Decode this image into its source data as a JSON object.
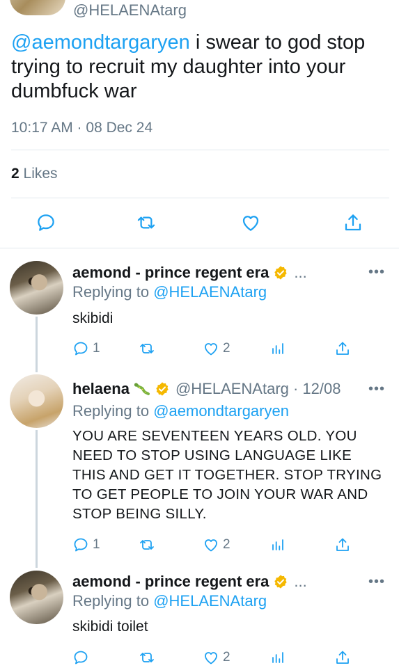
{
  "main_tweet": {
    "handle": "@HELAENAtarg",
    "mention": "@aemondtargaryen",
    "text": " i swear to god stop trying to recruit my daughter into your dumbfuck war",
    "timestamp": "10:17 AM · 08 Dec 24",
    "likes_count": "2",
    "likes_label": " Likes"
  },
  "replies": [
    {
      "name": "aemond - prince regent era",
      "handle": "",
      "ellipsis": "...",
      "replying_label": "Replying to ",
      "replying_to": "@HELAENAtarg",
      "text": "skibidi",
      "reply_count": "1",
      "like_count": "2"
    },
    {
      "name": "helaena",
      "handle": "@HELAENAtarg · 12/08",
      "replying_label": "Replying to ",
      "replying_to": "@aemondtargaryen",
      "text": "YOU ARE SEVENTEEN YEARS OLD. YOU NEED TO STOP USING LANGUAGE LIKE THIS AND GET IT TOGETHER. STOP TRYING TO GET PEOPLE TO JOIN YOUR WAR AND STOP BEING SILLY.",
      "reply_count": "1",
      "like_count": "2"
    },
    {
      "name": "aemond - prince regent era",
      "ellipsis": "...",
      "replying_label": "Replying to ",
      "replying_to": "@HELAENAtarg",
      "text": "skibidi toilet",
      "reply_count": "",
      "like_count": "2"
    }
  ],
  "more_label": "•••",
  "colors": {
    "link": "#1da1f2",
    "muted": "#657786",
    "badge": "#f5b800"
  },
  "icons": [
    "reply-icon",
    "retweet-icon",
    "like-icon",
    "share-icon",
    "analytics-icon",
    "verified-badge-icon",
    "snake-emoji-icon",
    "more-icon"
  ]
}
